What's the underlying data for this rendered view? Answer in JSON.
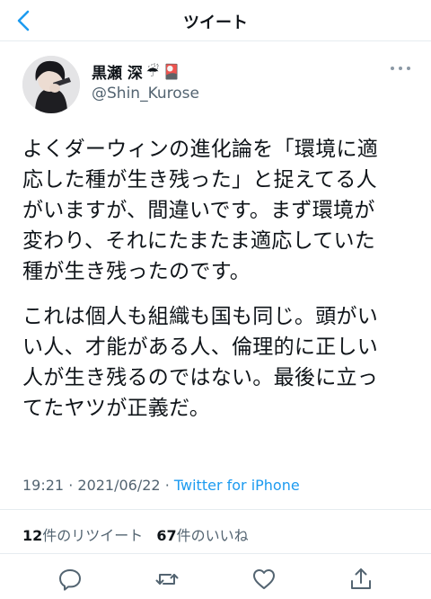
{
  "header": {
    "title": "ツイート",
    "back_icon": "chevron-left-icon"
  },
  "author": {
    "name": "黒瀬 深",
    "emoji_1": "☔",
    "emoji_2": "🎴",
    "handle": "@Shin_Kurose"
  },
  "tweet": {
    "paragraph_1_lines": [
      "よくダーウィンの進化論を「環境に適",
      "応した種が生き残った」と捉えてる人",
      "がいますが、間違いです。まず環境が",
      "変わり、それにたまたま適応していた",
      "種が生き残ったのです。"
    ],
    "paragraph_2_lines": [
      "これは個人も組織も国も同じ。頭がい",
      "い人、才能がある人、倫理的に正しい",
      "人が生き残るのではない。最後に立っ",
      "てたヤツが正義だ。"
    ]
  },
  "meta": {
    "time": "19:21",
    "dot_1": "·",
    "date": "2021/06/22",
    "dot_2": "·",
    "source": "Twitter for iPhone"
  },
  "stats": {
    "retweets_count": "12",
    "retweets_label": "件のリツイート",
    "likes_count": "67",
    "likes_label": "件のいいね"
  },
  "actions": [
    "reply-icon",
    "retweet-icon",
    "like-icon",
    "share-icon"
  ],
  "colors": {
    "accent": "#1d9bf0",
    "secondary_text": "#536471",
    "divider": "#e6ecf0"
  }
}
